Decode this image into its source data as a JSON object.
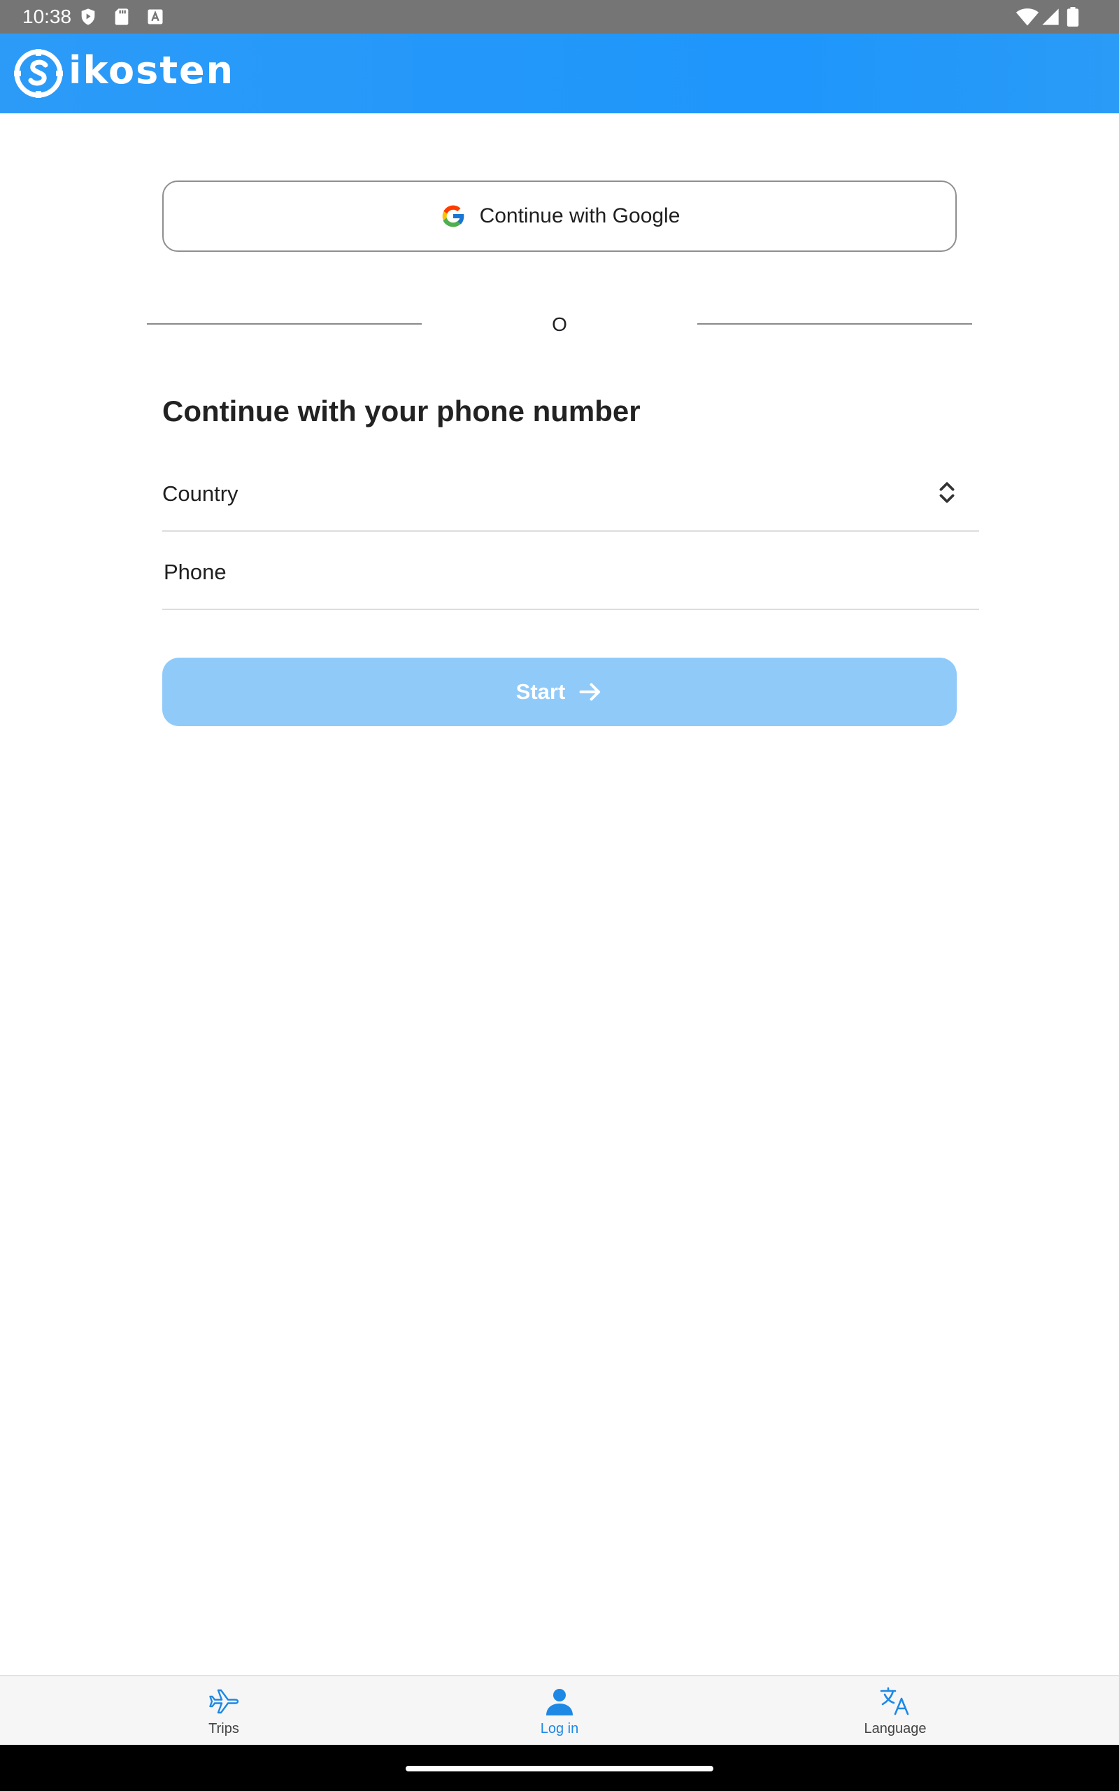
{
  "status_bar": {
    "time": "10:38"
  },
  "header": {
    "logo_text": "ikosten"
  },
  "login": {
    "google_button_label": "Continue with Google",
    "divider_text": "O",
    "phone_section_title": "Continue with your phone number",
    "country_label": "Country",
    "phone_placeholder": "Phone",
    "phone_value": "",
    "start_button_label": "Start"
  },
  "bottom_nav": {
    "items": [
      {
        "label": "Trips",
        "icon": "airplane-icon",
        "active": false
      },
      {
        "label": "Log in",
        "icon": "person-icon",
        "active": true
      },
      {
        "label": "Language",
        "icon": "translate-icon",
        "active": false
      }
    ]
  },
  "colors": {
    "brand_blue": "#1e96fb",
    "start_button_disabled": "#90caf9",
    "active_nav": "#1e88e5"
  }
}
